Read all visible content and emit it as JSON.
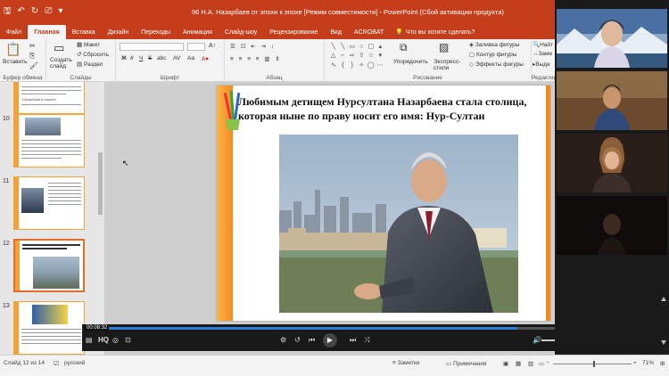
{
  "window": {
    "title": "96 Н.А. Назарбаев от эпохи к эпохе [Режим совместимости] - PowerPoint (Сбой активации продукта)"
  },
  "tabs": [
    "Файл",
    "Главная",
    "Вставка",
    "Дизайн",
    "Переходы",
    "Анимация",
    "Слайд-шоу",
    "Рецензирование",
    "Вид",
    "ACROBAT"
  ],
  "active_tab": "Главная",
  "tell_me": "Что вы хотите сделать?",
  "ribbon": {
    "clipboard": {
      "paste": "Вставить",
      "label": "Буфер обмена"
    },
    "slides": {
      "new_slide": "Создать слайд",
      "layout": "Макет",
      "reset": "Сбросить",
      "section": "Раздел",
      "label": "Слайды"
    },
    "font": {
      "label": "Шрифт",
      "bold": "Ж",
      "italic": "К",
      "underline": "Ч",
      "strike": "S",
      "shadow": "abc"
    },
    "paragraph": {
      "label": "Абзац"
    },
    "drawing": {
      "arrange": "Упорядочить",
      "quick_styles": "Экспресс-стили",
      "fill": "Заливка фигуры",
      "outline": "Контур фигуры",
      "effects": "Эффекты фигуры",
      "label": "Рисование"
    },
    "editing": {
      "find": "Найт",
      "replace": "Заме",
      "select": "Выде",
      "label": "Редактиро"
    }
  },
  "thumbnails": [
    {
      "num": "",
      "caption": "Назарбаев в апреле"
    },
    {
      "num": "10"
    },
    {
      "num": "11"
    },
    {
      "num": "12"
    },
    {
      "num": "13"
    }
  ],
  "slide": {
    "title": "Любимым детищем Нурсултана Назарбаева стала столица, которая ныне по праву носит его имя: Нур-Султан"
  },
  "video": {
    "time": "00:08:32",
    "quality": "HQ",
    "progress": 0.87
  },
  "status": {
    "slide_info": "Слайд 12 из 14",
    "language": "русский",
    "notes": "Заметки",
    "comments": "Примечания",
    "zoom": "71%"
  },
  "zoom_zoom": 0.71,
  "colors": {
    "powerpoint_red": "#c43e1c",
    "slide_orange": "#f58a1f",
    "video_accent": "#2b7cd3"
  }
}
